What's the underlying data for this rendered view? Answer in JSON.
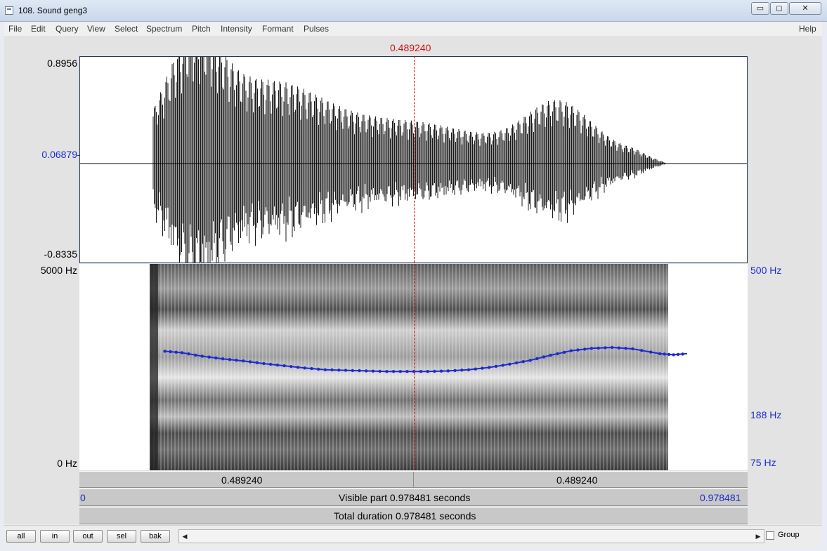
{
  "window": {
    "title": "108. Sound geng3",
    "buttons": {
      "minimize": "▭",
      "maximize": "◻",
      "close": "✕"
    }
  },
  "menu": {
    "items": [
      "File",
      "Edit",
      "Query",
      "View",
      "Select",
      "Spectrum",
      "Pitch",
      "Intensity",
      "Formant",
      "Pulses"
    ],
    "help": "Help"
  },
  "cursor": {
    "time_label": "0.489240",
    "time": 0.48924
  },
  "waveform": {
    "y_max": "0.8956",
    "y_mid": "0.06879",
    "y_min": "-0.8335"
  },
  "spectrogram": {
    "freq_top": "5000 Hz",
    "freq_bottom": "0 Hz",
    "pitch_top": "500 Hz",
    "pitch_cursor": "188 Hz",
    "pitch_bottom": "75 Hz",
    "pitch_floor_hz": 75,
    "pitch_ceiling_hz": 500
  },
  "time_bar": {
    "left_label": "0.489240",
    "right_label": "0.489240"
  },
  "visible_bar": {
    "start": "0",
    "text": "Visible part 0.978481 seconds",
    "end": "0.978481"
  },
  "total_bar": {
    "text": "Total duration 0.978481 seconds"
  },
  "bottom": {
    "buttons": [
      "all",
      "in",
      "out",
      "sel",
      "bak"
    ],
    "group_label": "Group",
    "scroll_left": "◀",
    "scroll_right": "▶"
  },
  "colors": {
    "cursor": "#d4110f",
    "pitch": "#1f2bcc",
    "wave": "#000000"
  },
  "pitch_track": {
    "time_s": [
      0.125,
      0.15,
      0.18,
      0.21,
      0.24,
      0.27,
      0.3,
      0.33,
      0.36,
      0.39,
      0.42,
      0.45,
      0.48,
      0.51,
      0.54,
      0.57,
      0.6,
      0.63,
      0.66,
      0.69,
      0.72,
      0.75,
      0.78,
      0.81,
      0.85,
      0.87,
      0.89
    ],
    "f0_hz": [
      224,
      221,
      214,
      209,
      205,
      200,
      196,
      192,
      189,
      188,
      187,
      186,
      186,
      186,
      187,
      189,
      193,
      199,
      206,
      216,
      225,
      230,
      232,
      229,
      219,
      217,
      219
    ]
  }
}
